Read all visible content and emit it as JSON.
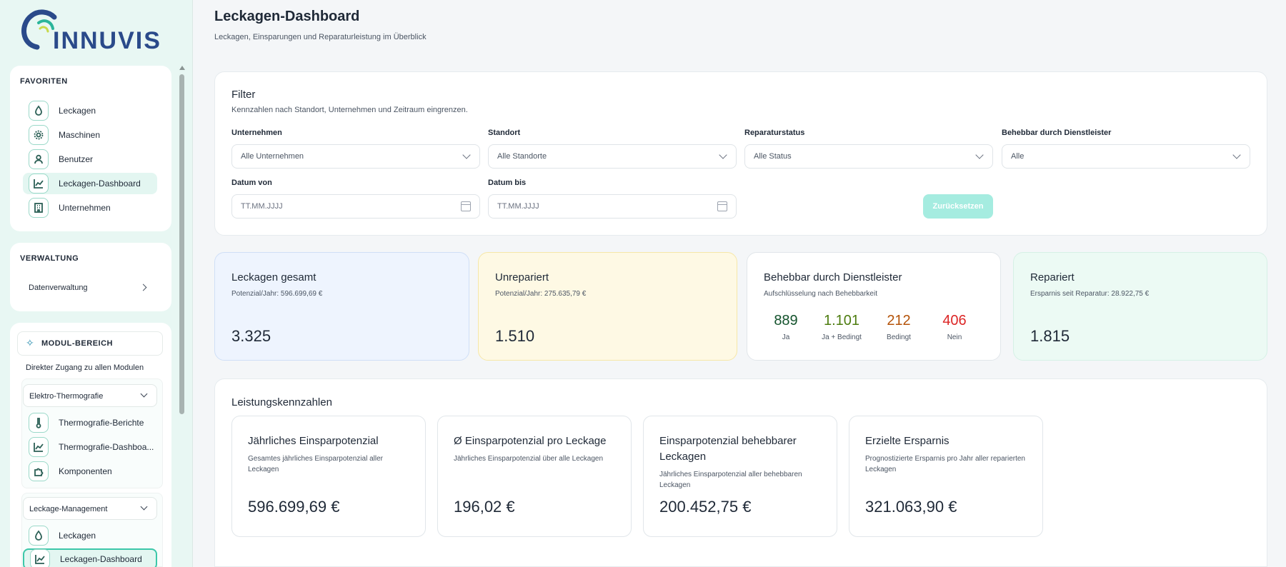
{
  "logo": {
    "text": "INNUVIS"
  },
  "sidebar": {
    "favorites_title": "FAVORITEN",
    "favorites": [
      {
        "label": "Leckagen",
        "icon": "droplet-icon"
      },
      {
        "label": "Maschinen",
        "icon": "gear-icon"
      },
      {
        "label": "Benutzer",
        "icon": "user-icon"
      },
      {
        "label": "Leckagen-Dashboard",
        "icon": "line-chart-icon",
        "active": true
      },
      {
        "label": "Unternehmen",
        "icon": "building-icon"
      }
    ],
    "admin_title": "VERWALTUNG",
    "admin_item": "Datenverwaltung",
    "module_title": "MODUL-BEREICH",
    "module_sub": "Direkter Zugang zu allen Modulen",
    "groups": [
      {
        "label": "Elektro-Thermografie",
        "items": [
          {
            "label": "Thermografie-Berichte",
            "icon": "thermometer-icon"
          },
          {
            "label": "Thermografie-Dashboa...",
            "icon": "line-chart-icon"
          },
          {
            "label": "Komponenten",
            "icon": "puzzle-icon"
          }
        ]
      },
      {
        "label": "Leckage-Management",
        "items": [
          {
            "label": "Leckagen",
            "icon": "droplet-icon"
          },
          {
            "label": "Leckagen-Dashboard",
            "icon": "line-chart-icon",
            "active": true
          }
        ]
      }
    ]
  },
  "header": {
    "title": "Leckagen-Dashboard",
    "subtitle": "Leckagen, Einsparungen und Reparaturleistung im Überblick"
  },
  "filter": {
    "title": "Filter",
    "subtitle": "Kennzahlen nach Standort, Unternehmen und Zeitraum eingrenzen.",
    "company_label": "Unternehmen",
    "company_value": "Alle Unternehmen",
    "location_label": "Standort",
    "location_value": "Alle Standorte",
    "status_label": "Reparaturstatus",
    "status_value": "Alle Status",
    "fixable_label": "Behebbar durch Dienstleister",
    "fixable_value": "Alle",
    "date_from_label": "Datum von",
    "date_from_placeholder": "TT.MM.JJJJ",
    "date_to_label": "Datum bis",
    "date_to_placeholder": "TT.MM.JJJJ",
    "reset_label": "Zurücksetzen"
  },
  "kpis": {
    "total": {
      "title": "Leckagen gesamt",
      "sub": "Potenzial/Jahr: 596.699,69 €",
      "value": "3.325"
    },
    "unrepaired": {
      "title": "Unrepariert",
      "sub": "Potenzial/Jahr: 275.635,79 €",
      "value": "1.510"
    },
    "fixable": {
      "title": "Behebbar durch Dienstleister",
      "sub": "Aufschlüsselung nach Behebbarkeit",
      "items": [
        {
          "value": "889",
          "label": "Ja"
        },
        {
          "value": "1.101",
          "label": "Ja + Bedingt"
        },
        {
          "value": "212",
          "label": "Bedingt"
        },
        {
          "value": "406",
          "label": "Nein"
        }
      ]
    },
    "repaired": {
      "title": "Repariert",
      "sub": "Ersparnis seit Reparatur: 28.922,75 €",
      "value": "1.815"
    }
  },
  "performance": {
    "title": "Leistungskennzahlen",
    "cards": [
      {
        "title": "Jährliches Einsparpotenzial",
        "sub": "Gesamtes jährliches Einsparpotenzial aller Leckagen",
        "value": "596.699,69 €"
      },
      {
        "title": "Ø Einsparpotenzial pro Leckage",
        "sub": "Jährliches Einsparpotenzial über alle Leckagen",
        "value": "196,02 €"
      },
      {
        "title": "Einsparpotenzial behebbarer Leckagen",
        "sub": "Jährliches Einsparpotenzial aller behebbaren Leckagen",
        "value": "200.452,75 €"
      },
      {
        "title": "Erzielte Ersparnis",
        "sub": "Prognostizierte Ersparnis pro Jahr aller reparierten Leckagen",
        "value": "321.063,90 €"
      }
    ]
  },
  "colors": {
    "accent": "#2bb59a",
    "ja": "#14532d",
    "ja_bedingt": "#4d7c0f",
    "bedingt": "#b45309",
    "nein": "#dc2626",
    "total_bg": "#eef4fe",
    "unrepaired_bg": "#fef9e4",
    "repaired_bg": "#ecfaf4"
  }
}
